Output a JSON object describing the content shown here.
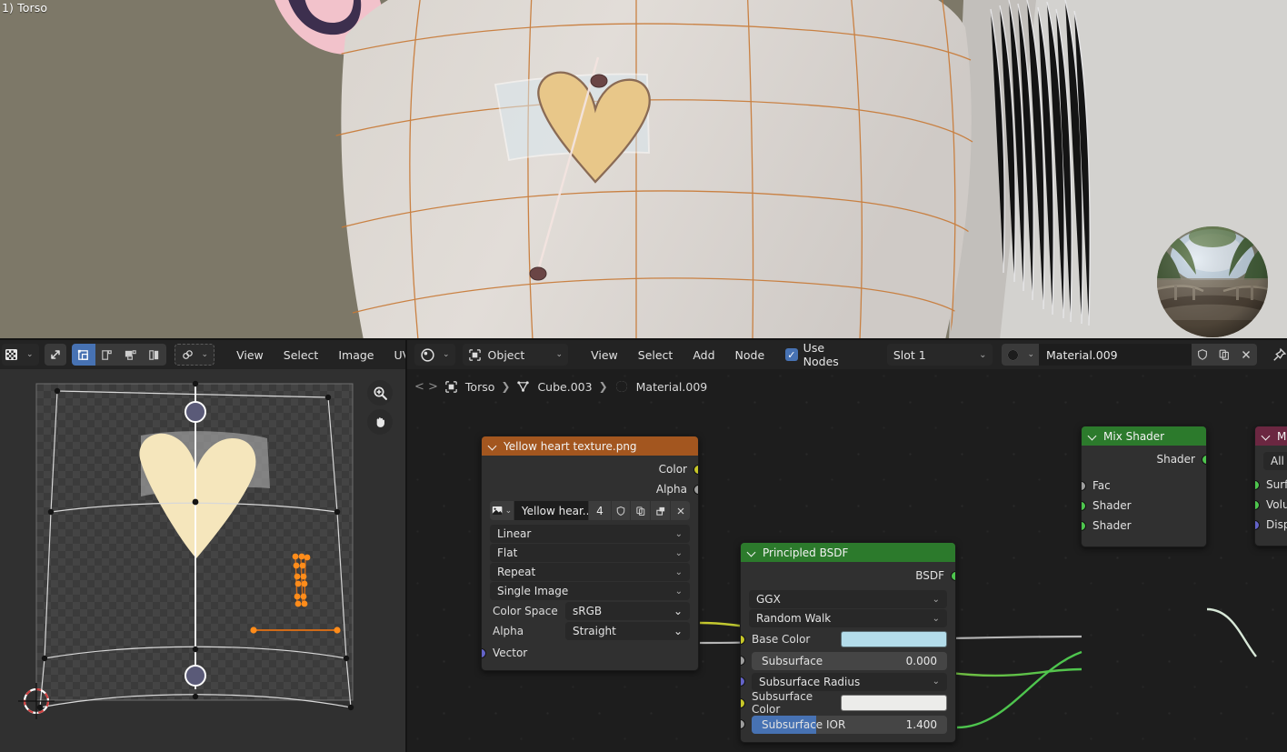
{
  "viewport": {
    "overlay_label": "1) Torso",
    "background_color": "#7d7868",
    "mesh_wire_color": "#c87a37",
    "body_color": "#ddd9d4",
    "scarf_color": "#a9cdd6",
    "heart_color": "#e8c789",
    "ear_pink": "#f2c2cb",
    "ear_dark": "#3d2f4e",
    "hdri_ball_name": "lookdev-hdri-sphere"
  },
  "uv_editor": {
    "header": {
      "mode_icon": "uv-editor-mode-icon",
      "sync_icon": "uv-sync-selection-icon",
      "select_modes": [
        {
          "name": "uv-select-vertex",
          "active": true
        },
        {
          "name": "uv-select-edge",
          "active": false
        },
        {
          "name": "uv-select-face",
          "active": false
        },
        {
          "name": "uv-select-island",
          "active": false
        }
      ],
      "sticky_icon": "uv-sticky-selection-icon",
      "menus": [
        "View",
        "Select",
        "Image",
        "UV"
      ]
    },
    "gizmos": [
      {
        "name": "zoom-gizmo",
        "glyph": "zoom-in-icon"
      },
      {
        "name": "pan-gizmo",
        "glyph": "hand-icon"
      }
    ],
    "image_name": "Yellow heart texture.png",
    "selection_color": "#ff8c1a"
  },
  "shader_editor": {
    "header": {
      "shader_type_icon": "shading-type-icon",
      "context_label": "Object",
      "context_icon": "object-icon",
      "menus": [
        "View",
        "Select",
        "Add",
        "Node"
      ],
      "use_nodes_label": "Use Nodes",
      "use_nodes_checked": true,
      "slot_label": "Slot 1",
      "material_icon": "material-sphere-icon",
      "material_name": "Material.009",
      "fake_user_icon": "shield-icon",
      "new_material_icon": "duplicate-icon",
      "unlink_icon": "close-icon",
      "pin_icon": "pin-icon"
    },
    "breadcrumb": [
      {
        "icon": "object-icon",
        "label": "Torso"
      },
      {
        "icon": "mesh-data-icon",
        "label": "Cube.003"
      },
      {
        "icon": "material-sphere-icon",
        "label": "Material.009"
      }
    ],
    "nodes": [
      {
        "id": "image-texture-node",
        "title": "Yellow heart texture.png",
        "header_color": "#a3561f",
        "outputs": [
          {
            "label": "Color",
            "socket": "yellow"
          },
          {
            "label": "Alpha",
            "socket": "gray"
          }
        ],
        "datablock": {
          "icon": "image-datablock-icon",
          "name": "Yellow hear...",
          "users": "4",
          "buttons": [
            "shield-icon",
            "duplicate-icon",
            "pack-icon",
            "close-icon"
          ]
        },
        "dropdowns": [
          "Linear",
          "Flat",
          "Repeat",
          "Single Image"
        ],
        "properties": [
          {
            "label": "Color Space",
            "value": "sRGB"
          },
          {
            "label": "Alpha",
            "value": "Straight"
          }
        ],
        "inputs": [
          {
            "label": "Vector",
            "socket": "purple"
          }
        ]
      },
      {
        "id": "principled-bsdf-node",
        "title": "Principled BSDF",
        "header_color": "#2c7a2c",
        "outputs": [
          {
            "label": "BSDF",
            "socket": "green"
          }
        ],
        "dropdowns": [
          "GGX",
          "Random Walk"
        ],
        "inputs": [
          {
            "label": "Base Color",
            "socket": "yellow",
            "type": "color",
            "color": "#b3dcea"
          },
          {
            "label": "Subsurface",
            "socket": "gray",
            "type": "slider",
            "value": "0.000"
          },
          {
            "label": "Subsurface Radius",
            "socket": "purple",
            "type": "dropdown"
          },
          {
            "label": "Subsurface Color",
            "socket": "yellow",
            "type": "color",
            "color": "#ececea"
          },
          {
            "label": "Subsurface IOR",
            "socket": "gray",
            "type": "slider",
            "value": "1.400"
          }
        ]
      },
      {
        "id": "mix-shader-node",
        "title": "Mix Shader",
        "header_color": "#2c7a2c",
        "outputs": [
          {
            "label": "Shader",
            "socket": "green"
          }
        ],
        "inputs": [
          {
            "label": "Fac",
            "socket": "gray"
          },
          {
            "label": "Shader",
            "socket": "green"
          },
          {
            "label": "Shader",
            "socket": "green"
          }
        ]
      },
      {
        "id": "material-output-node",
        "title": "Mat",
        "header_color": "#6b2741",
        "dropdowns": [
          "All"
        ],
        "inputs": [
          {
            "label": "Surfac",
            "socket": "green"
          },
          {
            "label": "Volum",
            "socket": "green"
          },
          {
            "label": "Displa",
            "socket": "purple"
          }
        ]
      }
    ],
    "link_colors": {
      "color": "#c9c92e",
      "value": "#b5b5b5",
      "shader": "#4ec54e"
    }
  }
}
